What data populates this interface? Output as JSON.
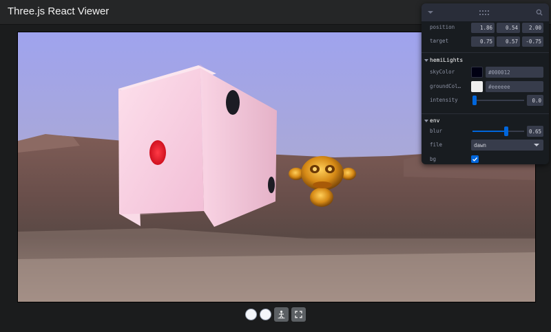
{
  "header": {
    "title": "Three.js React Viewer"
  },
  "panel": {
    "camera": {
      "position": {
        "label": "position",
        "values": [
          "1.86",
          "0.54",
          "2.00"
        ]
      },
      "target": {
        "label": "target",
        "values": [
          "0.75",
          "0.57",
          "-0.75"
        ]
      }
    },
    "hemiLights": {
      "title": "hemiLights",
      "skyColor": {
        "label": "skyColor",
        "value": "#000012"
      },
      "groundColor": {
        "label": "groundCol…",
        "value": "#eeeeee"
      },
      "intensity": {
        "label": "intensity",
        "value": "0.0",
        "level": 0.0
      }
    },
    "env": {
      "title": "env",
      "blur": {
        "label": "blur",
        "value": "0.65",
        "level": 0.65
      },
      "file": {
        "label": "file",
        "value": "dawn"
      },
      "bg": {
        "label": "bg",
        "checked": true
      }
    }
  },
  "colors": {
    "accent": "#0066dc",
    "panel_bg": "#181c20",
    "field_bg": "#373c4b"
  }
}
